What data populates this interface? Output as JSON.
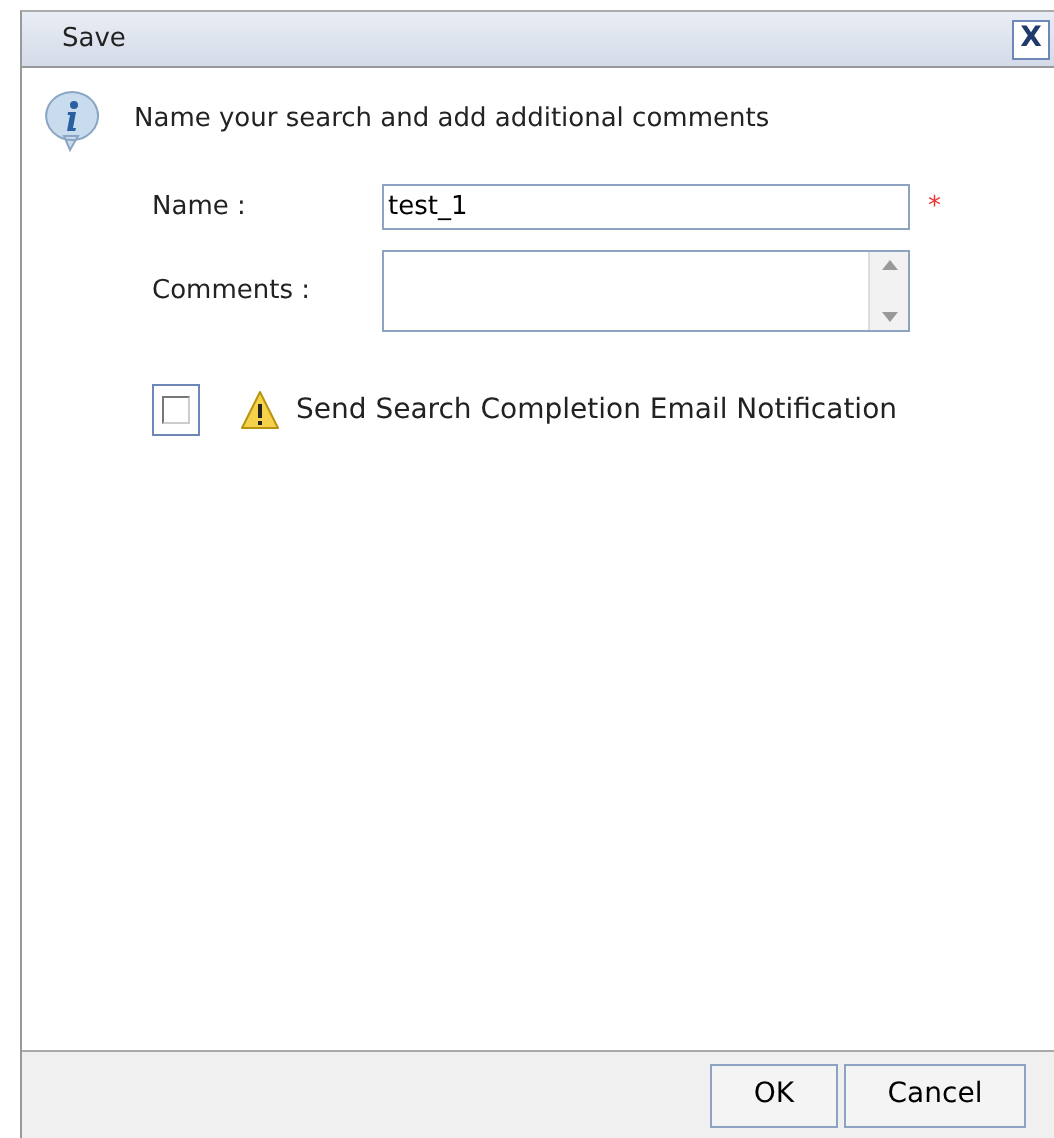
{
  "window": {
    "title": "Save",
    "close": "X"
  },
  "message": "Name your search and add additional comments",
  "fields": [
    {
      "kind": "text",
      "label": "Name :",
      "value": "test_1",
      "required_mark": "*"
    },
    {
      "kind": "textarea",
      "label": "Comments :"
    }
  ],
  "notification": {
    "label": "Send Search Completion Email Notification",
    "checked": false
  },
  "buttons": [
    "OK",
    "Cancel"
  ]
}
